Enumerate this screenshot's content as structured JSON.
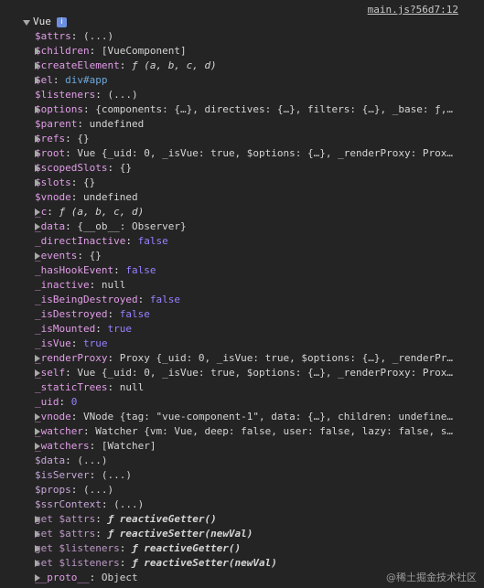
{
  "source": "main.js?56d7:12",
  "root_label": "Vue",
  "info_badge": "i",
  "rows": [
    {
      "expand": false,
      "key": "$attrs",
      "sep": ": ",
      "value": "(...)",
      "type": "obj"
    },
    {
      "expand": true,
      "key": "$children",
      "sep": ": ",
      "value": "[VueComponent]",
      "type": "obj"
    },
    {
      "expand": true,
      "key": "$createElement",
      "sep": ": ",
      "value": "ƒ (a, b, c, d)",
      "type": "fn"
    },
    {
      "expand": true,
      "key": "$el",
      "sep": ": ",
      "value": "div#app",
      "type": "tag"
    },
    {
      "expand": false,
      "key": "$listeners",
      "sep": ": ",
      "value": "(...)",
      "type": "obj"
    },
    {
      "expand": true,
      "key": "$options",
      "sep": ": ",
      "value": "{components: {…}, directives: {…}, filters: {…}, _base: ƒ,…",
      "type": "obj"
    },
    {
      "expand": false,
      "key": "$parent",
      "sep": ": ",
      "value": "undefined",
      "type": "obj"
    },
    {
      "expand": true,
      "key": "$refs",
      "sep": ": ",
      "value": "{}",
      "type": "obj"
    },
    {
      "expand": true,
      "key": "$root",
      "sep": ": ",
      "value": "Vue {_uid: 0, _isVue: true, $options: {…}, _renderProxy: Prox…",
      "type": "obj"
    },
    {
      "expand": true,
      "key": "$scopedSlots",
      "sep": ": ",
      "value": "{}",
      "type": "obj"
    },
    {
      "expand": true,
      "key": "$slots",
      "sep": ": ",
      "value": "{}",
      "type": "obj"
    },
    {
      "expand": false,
      "key": "$vnode",
      "sep": ": ",
      "value": "undefined",
      "type": "obj"
    },
    {
      "expand": true,
      "key": "_c",
      "sep": ": ",
      "value": "ƒ (a, b, c, d)",
      "type": "fn"
    },
    {
      "expand": true,
      "key": "_data",
      "sep": ": ",
      "value": "{__ob__: Observer}",
      "type": "obj"
    },
    {
      "expand": false,
      "key": "_directInactive",
      "sep": ": ",
      "value": "false",
      "type": "bool"
    },
    {
      "expand": true,
      "key": "_events",
      "sep": ": ",
      "value": "{}",
      "type": "obj"
    },
    {
      "expand": false,
      "key": "_hasHookEvent",
      "sep": ": ",
      "value": "false",
      "type": "bool"
    },
    {
      "expand": false,
      "key": "_inactive",
      "sep": ": ",
      "value": "null",
      "type": "obj"
    },
    {
      "expand": false,
      "key": "_isBeingDestroyed",
      "sep": ": ",
      "value": "false",
      "type": "bool"
    },
    {
      "expand": false,
      "key": "_isDestroyed",
      "sep": ": ",
      "value": "false",
      "type": "bool"
    },
    {
      "expand": false,
      "key": "_isMounted",
      "sep": ": ",
      "value": "true",
      "type": "bool"
    },
    {
      "expand": false,
      "key": "_isVue",
      "sep": ": ",
      "value": "true",
      "type": "bool"
    },
    {
      "expand": true,
      "key": "_renderProxy",
      "sep": ": ",
      "value": "Proxy {_uid: 0, _isVue: true, $options: {…}, _renderPr…",
      "type": "obj"
    },
    {
      "expand": true,
      "key": "_self",
      "sep": ": ",
      "value": "Vue {_uid: 0, _isVue: true, $options: {…}, _renderProxy: Prox…",
      "type": "obj"
    },
    {
      "expand": false,
      "key": "_staticTrees",
      "sep": ": ",
      "value": "null",
      "type": "obj"
    },
    {
      "expand": false,
      "key": "_uid",
      "sep": ": ",
      "value": "0",
      "type": "num"
    },
    {
      "expand": true,
      "key": "_vnode",
      "sep": ": ",
      "value": "VNode {tag: \"vue-component-1\", data: {…}, children: undefine…",
      "type": "obj"
    },
    {
      "expand": true,
      "key": "_watcher",
      "sep": ": ",
      "value": "Watcher {vm: Vue, deep: false, user: false, lazy: false, s…",
      "type": "obj"
    },
    {
      "expand": true,
      "key": "_watchers",
      "sep": ": ",
      "value": "[Watcher]",
      "type": "obj"
    },
    {
      "expand": false,
      "key": "$data",
      "sep": ": ",
      "value": "(...)",
      "type": "obj",
      "dim": true
    },
    {
      "expand": false,
      "key": "$isServer",
      "sep": ": ",
      "value": "(...)",
      "type": "obj",
      "dim": true
    },
    {
      "expand": false,
      "key": "$props",
      "sep": ": ",
      "value": "(...)",
      "type": "obj",
      "dim": true
    },
    {
      "expand": false,
      "key": "$ssrContext",
      "sep": ": ",
      "value": "(...)",
      "type": "obj",
      "dim": true
    },
    {
      "expand": true,
      "key": "get $attrs",
      "sep": ": ",
      "value": "ƒ reactiveGetter()",
      "type": "accessor"
    },
    {
      "expand": true,
      "key": "set $attrs",
      "sep": ": ",
      "value": "ƒ reactiveSetter(newVal)",
      "type": "accessor"
    },
    {
      "expand": true,
      "key": "get $listeners",
      "sep": ": ",
      "value": "ƒ reactiveGetter()",
      "type": "accessor"
    },
    {
      "expand": true,
      "key": "set $listeners",
      "sep": ": ",
      "value": "ƒ reactiveSetter(newVal)",
      "type": "accessor"
    },
    {
      "expand": true,
      "key": "__proto__",
      "sep": ": ",
      "value": "Object",
      "type": "obj"
    }
  ],
  "watermark": "@稀土掘金技术社区"
}
